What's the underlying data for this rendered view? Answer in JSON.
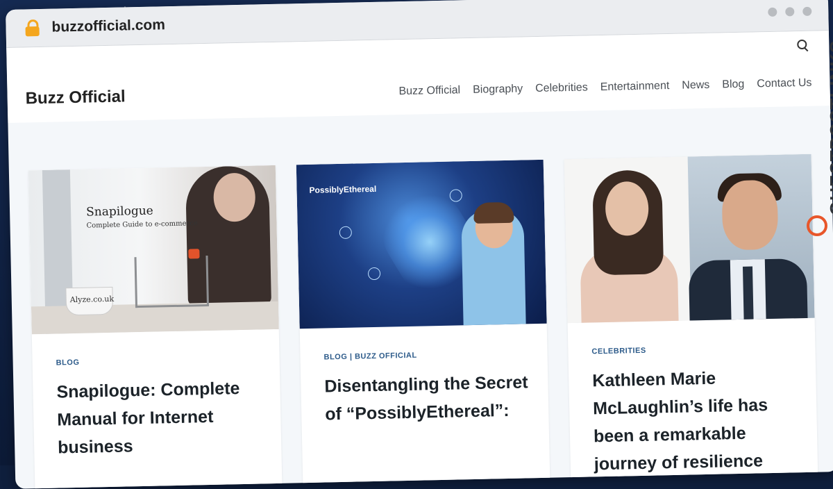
{
  "browser": {
    "url": "buzzofficial.com"
  },
  "site": {
    "brand": "Buzz Official",
    "nav": [
      "Buzz Official",
      "Biography",
      "Celebrities",
      "Entertainment",
      "News",
      "Blog",
      "Contact Us"
    ]
  },
  "cards": [
    {
      "category": "BLOG",
      "title": "Snapilogue: Complete Manual for Internet business",
      "image_text": {
        "title": "Snapilogue",
        "subtitle": "Complete Guide to e-commerce",
        "cup": "Alyze.co.uk"
      }
    },
    {
      "category": "BLOG | BUZZ OFFICIAL",
      "title": "Disentangling the Secret of “PossiblyEthereal”:",
      "image_text": {
        "label": "PossiblyEthereal"
      }
    },
    {
      "category": "CELEBRITIES",
      "title": "Kathleen Marie McLaughlin’s life has been a remarkable journey of resilience"
    }
  ],
  "watermark": "GUESTPOSTLINKS"
}
